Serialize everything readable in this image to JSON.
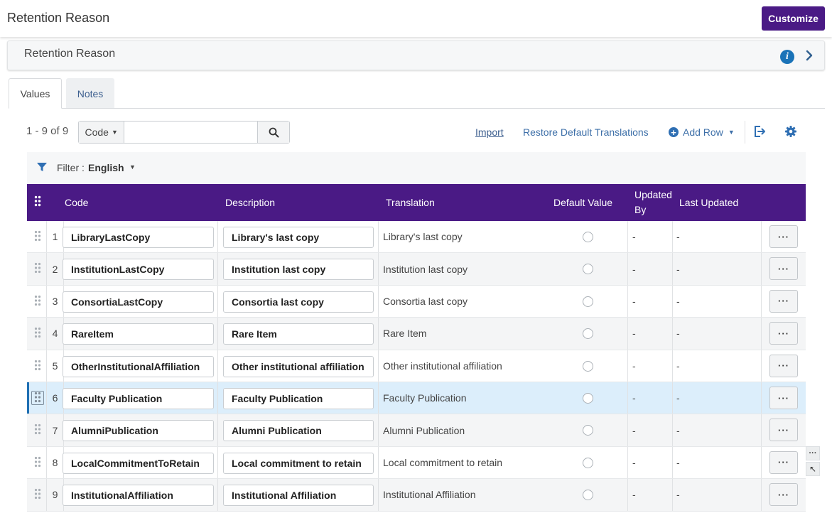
{
  "page": {
    "title": "Retention Reason",
    "customize_label": "Customize"
  },
  "section": {
    "title": "Retention Reason",
    "info_glyph": "i"
  },
  "tabs": [
    {
      "label": "Values",
      "active": true
    },
    {
      "label": "Notes",
      "active": false
    }
  ],
  "toolbar": {
    "count": "1 - 9 of 9",
    "search_field": "Code",
    "search_value": "",
    "import_label": "Import",
    "restore_label": "Restore Default Translations",
    "add_row_label": "Add Row"
  },
  "filter": {
    "label": "Filter :",
    "value": "English"
  },
  "table": {
    "headers": {
      "code": "Code",
      "description": "Description",
      "translation": "Translation",
      "default_value": "Default Value",
      "updated_by_1": "Updated",
      "updated_by_2": "By",
      "last_updated": "Last Updated"
    },
    "rows": [
      {
        "num": "1",
        "code": "LibraryLastCopy",
        "description": "Library's last copy",
        "translation": "Library's last copy",
        "updated_by": "-",
        "last_updated": "-",
        "more": "···"
      },
      {
        "num": "2",
        "code": "InstitutionLastCopy",
        "description": "Institution last copy",
        "translation": "Institution last copy",
        "updated_by": "-",
        "last_updated": "-",
        "more": "···"
      },
      {
        "num": "3",
        "code": "ConsortiaLastCopy",
        "description": "Consortia last copy",
        "translation": "Consortia last copy",
        "updated_by": "-",
        "last_updated": "-",
        "more": "···"
      },
      {
        "num": "4",
        "code": "RareItem",
        "description": "Rare Item",
        "translation": "Rare Item",
        "updated_by": "-",
        "last_updated": "-",
        "more": "···"
      },
      {
        "num": "5",
        "code": "OtherInstitutionalAffiliation",
        "description": "Other institutional affiliation",
        "translation": "Other institutional affiliation",
        "updated_by": "-",
        "last_updated": "-",
        "more": "···"
      },
      {
        "num": "6",
        "code": "Faculty Publication",
        "description": "Faculty Publication",
        "translation": "Faculty Publication",
        "updated_by": "-",
        "last_updated": "-",
        "more": "···"
      },
      {
        "num": "7",
        "code": "AlumniPublication",
        "description": "Alumni Publication",
        "translation": "Alumni Publication",
        "updated_by": "-",
        "last_updated": "-",
        "more": "···"
      },
      {
        "num": "8",
        "code": "LocalCommitmentToRetain",
        "description": "Local commitment to retain",
        "translation": "Local commitment to retain",
        "updated_by": "-",
        "last_updated": "-",
        "more": "···"
      },
      {
        "num": "9",
        "code": "InstitutionalAffiliation",
        "description": "Institutional Affiliation",
        "translation": "Institutional Affiliation",
        "updated_by": "-",
        "last_updated": "-",
        "more": "···"
      }
    ],
    "selected_row": "6"
  },
  "side_tools": {
    "more": "···",
    "arrow": "↖"
  },
  "colors": {
    "brand": "#4a1a85",
    "link": "#3d6fa8",
    "selected_row": "#dceefb",
    "selected_bar": "#1f6fb3"
  },
  "icons": [
    "info-icon",
    "chevron-right-icon",
    "search-icon",
    "plus-circle-icon",
    "export-icon",
    "gear-icon",
    "filter-icon",
    "drag-handle-icon",
    "caret-down-icon"
  ]
}
